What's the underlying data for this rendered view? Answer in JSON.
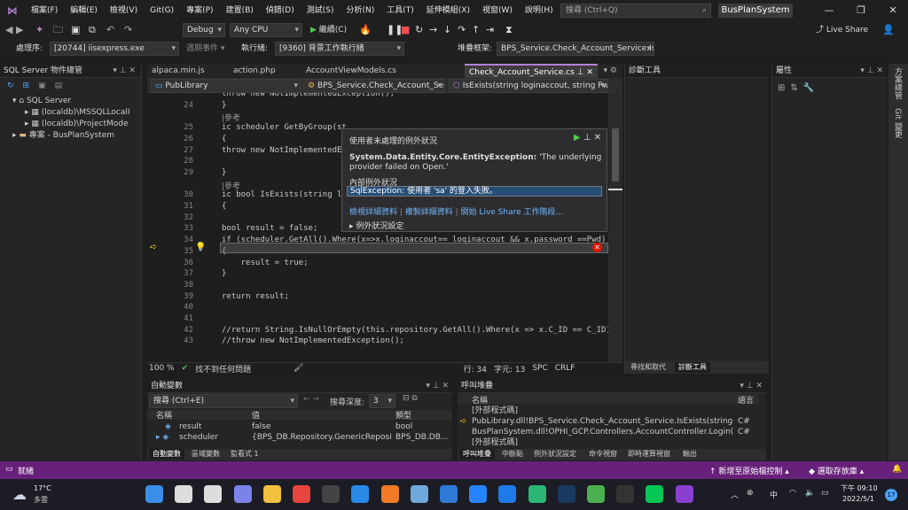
{
  "title_bar": {
    "menus": [
      "檔案(F)",
      "編輯(E)",
      "檢視(V)",
      "Git(G)",
      "專案(P)",
      "建置(B)",
      "偵錯(D)",
      "測試(S)",
      "分析(N)",
      "工具(T)",
      "延伸模組(X)",
      "視窗(W)",
      "說明(H)"
    ],
    "search": "搜尋 (Ctrl+Q)",
    "solution": "BusPlanSystem",
    "live_share": "Live Share"
  },
  "toolbar": {
    "debug": "Debug",
    "platform": "Any CPU",
    "continue": "繼續(C)",
    "process_label": "處理序:",
    "process": "[20744] iisexpress.exe",
    "lifecycle": "週期事件 ▾",
    "thread_label": "執行緒:",
    "thread": "[9360] 背景工作執行緒",
    "stack_label": "堆疊框架:",
    "stack": "BPS_Service.Check_Account_Service.IsEx"
  },
  "server_explorer": {
    "title": "SQL Server 物件總管",
    "items": [
      "SQL Server",
      "(localdb)\\MSSQLLocalI",
      "(localdb)\\ProjectMode",
      "專案 - BusPlanSystem"
    ]
  },
  "tabs": [
    "alpaca.min.js",
    "action.php",
    "AccountViewModels.cs",
    "Check_Account_Service.cs"
  ],
  "nav": {
    "project": "PubLibrary",
    "class": "BPS_Service.Check_Account_Servic",
    "member": "IsExists(string loginaccout, string Pw"
  },
  "code": {
    "lines": [
      {
        "n": "",
        "t": "throw new NotImplementedException();"
      },
      {
        "n": "24",
        "t": "}"
      },
      {
        "n": "",
        "t": "|參考"
      },
      {
        "n": "25",
        "t": "ic scheduler GetByGroup(st"
      },
      {
        "n": "26",
        "t": "{"
      },
      {
        "n": "27",
        "t": "throw new NotImplementedEx"
      },
      {
        "n": "28",
        "t": ""
      },
      {
        "n": "29",
        "t": "}"
      },
      {
        "n": "",
        "t": "|參考"
      },
      {
        "n": "30",
        "t": "ic bool IsExists(string lo"
      },
      {
        "n": "31",
        "t": "{"
      },
      {
        "n": "32",
        "t": ""
      },
      {
        "n": "33",
        "t": "bool result = false;"
      },
      {
        "n": "34",
        "t": "if (scheduler.GetAll().Where(x=>x.loginaccout== loginaccout && x.password ==Pwd)"
      },
      {
        "n": "35",
        "t": "{"
      },
      {
        "n": "36",
        "t": "    result = true;"
      },
      {
        "n": "37",
        "t": "}"
      },
      {
        "n": "38",
        "t": ""
      },
      {
        "n": "39",
        "t": "return result;"
      },
      {
        "n": "40",
        "t": ""
      },
      {
        "n": "41",
        "t": ""
      },
      {
        "n": "42",
        "t": "//return String.IsNullOrEmpty(this.repository.GetAll().Where(x => x.C_ID == C_ID).W"
      },
      {
        "n": "43",
        "t": "//throw new NotImplementedException();"
      }
    ]
  },
  "exception": {
    "title": "使用者未處理的例外狀況",
    "type": "System.Data.Entity.Core.EntityException:",
    "message": "'The underlying provider failed on Open.'",
    "inner_label": "內部例外狀況",
    "inner": "SqlException: 使用者 'sa' 的登入失敗。",
    "links": [
      "檢視詳細資料",
      "複製詳細資料",
      "開始 Live Share 工作階段..."
    ],
    "settings": "例外狀況設定"
  },
  "editor_status": {
    "zoom": "100 %",
    "issues": "找不到任何問題",
    "line": "行: 34",
    "col": "字元: 13",
    "spc": "SPC",
    "crlf": "CRLF"
  },
  "diag": {
    "title": "診斷工具",
    "tabs": [
      "尋找和取代",
      "診斷工具"
    ]
  },
  "props": {
    "title": "屬性"
  },
  "side_tabs": [
    "方案總管",
    "Git 變更"
  ],
  "autos": {
    "title": "自動變數",
    "search": "搜尋 (Ctrl+E)",
    "depth_label": "搜尋深度:",
    "depth": "3",
    "headers": [
      "名稱",
      "值",
      "類型"
    ],
    "rows": [
      {
        "name": "result",
        "value": "false",
        "type": "bool"
      },
      {
        "name": "scheduler",
        "value": "{BPS_DB.Repository.GenericRepository...",
        "type": "BPS_DB.DB..."
      }
    ],
    "tabs": [
      "自動變數",
      "區域變數",
      "監看式 1"
    ]
  },
  "callstack": {
    "title": "呼叫堆疊",
    "headers": [
      "名稱",
      "語言"
    ],
    "rows": [
      {
        "name": "[外部程式碼]",
        "lang": ""
      },
      {
        "name": "PubLibrary.dll!BPS_Service.Check_Account_Service.IsExists(string loginac...",
        "lang": "C#"
      },
      {
        "name": "BusPlanSystem.dll!OPHI_GCP.Controllers.AccountController.Login(BusPl...",
        "lang": "C#"
      },
      {
        "name": "[外部程式碼]",
        "lang": ""
      }
    ],
    "tabs": [
      "呼叫堆疊",
      "中斷點",
      "例外狀況設定",
      "命令視窗",
      "即時運算視窗",
      "輸出"
    ]
  },
  "statusbar": {
    "ready": "就緒",
    "source": "新增至原始檔控制",
    "repo": "選取存放庫"
  },
  "taskbar": {
    "temp": "17°C",
    "weather": "多雲",
    "ime": "中",
    "time": "下午 09:10",
    "date": "2022/5/1",
    "badge": "17"
  }
}
